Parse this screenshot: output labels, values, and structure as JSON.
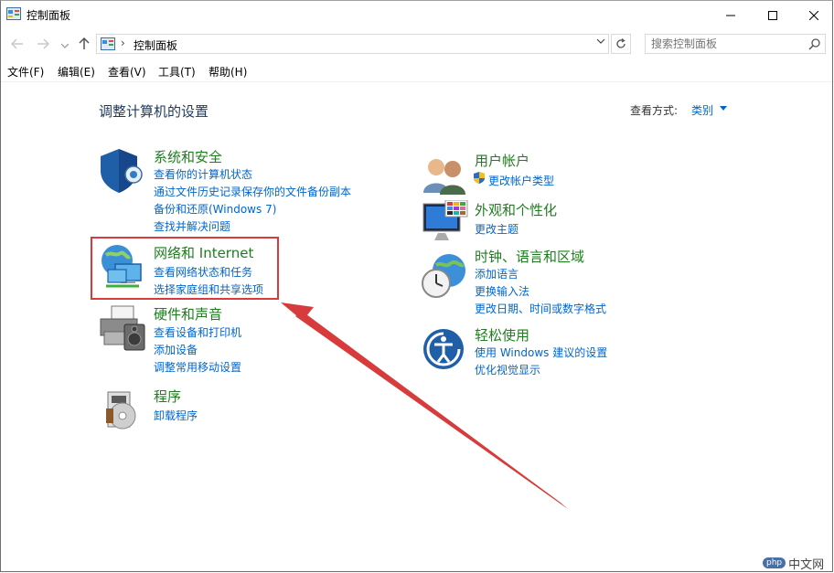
{
  "window": {
    "title": "控制面板"
  },
  "address": {
    "path": "控制面板"
  },
  "search": {
    "placeholder": "搜索控制面板"
  },
  "menu": [
    "文件(F)",
    "编辑(E)",
    "查看(V)",
    "工具(T)",
    "帮助(H)"
  ],
  "main": {
    "heading": "调整计算机的设置",
    "view_by_label": "查看方式:",
    "view_by_value": "类别",
    "categories": [
      {
        "title": "系统和安全",
        "icon": "shield-icon",
        "links": [
          "查看你的计算机状态",
          "通过文件历史记录保存你的文件备份副本",
          "备份和还原(Windows 7)",
          "查找并解决问题"
        ]
      },
      {
        "title": "网络和 Internet",
        "icon": "network-globe-icon",
        "links": [
          "查看网络状态和任务",
          "选择家庭组和共享选项"
        ]
      },
      {
        "title": "硬件和声音",
        "icon": "printer-speaker-icon",
        "links": [
          "查看设备和打印机",
          "添加设备",
          "调整常用移动设置"
        ]
      },
      {
        "title": "程序",
        "icon": "programs-disc-icon",
        "links": [
          "卸载程序"
        ]
      },
      {
        "title": "用户帐户",
        "icon": "users-icon",
        "links": [
          "更改帐户类型"
        ]
      },
      {
        "title": "外观和个性化",
        "icon": "monitor-palette-icon",
        "links": [
          "更改主题"
        ]
      },
      {
        "title": "时钟、语言和区域",
        "icon": "clock-globe-icon",
        "links": [
          "添加语言",
          "更换输入法",
          "更改日期、时间或数字格式"
        ]
      },
      {
        "title": "轻松使用",
        "icon": "ease-of-access-icon",
        "links": [
          "使用 Windows 建议的设置",
          "优化视觉显示"
        ]
      }
    ]
  },
  "annotation": {
    "color": "#d73b3b"
  },
  "watermark": {
    "badge": "php",
    "text": "中文网"
  }
}
